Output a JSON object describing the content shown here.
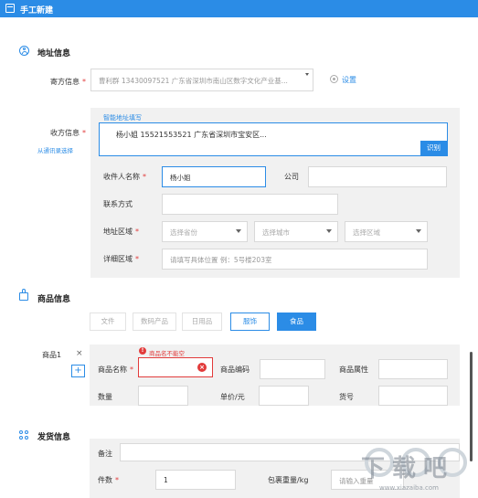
{
  "window": {
    "title": "手工新建"
  },
  "address": {
    "section_title": "地址信息",
    "sender_label": "寄方信息",
    "sender_value": "曹利群 13430097521 广东省深圳市南山区数字文化产业基...",
    "settings_label": "设置",
    "receiver_label": "收方信息",
    "from_address_book": "从通讯录选择",
    "smart_fill_label": "智能地址填写",
    "smart_fill_text": "杨小姐 15521553521 广东省深圳市宝安区...",
    "recognize_button": "识别",
    "name_label": "收件人名称",
    "name_value": "杨小姐",
    "company_label": "公司",
    "contact_label": "联系方式",
    "region_label": "地址区域",
    "province_placeholder": "选择省份",
    "city_placeholder": "选择城市",
    "district_placeholder": "选择区域",
    "detail_label": "详细区域",
    "detail_placeholder": "请填写具体位置 例：5号楼203室"
  },
  "goods": {
    "section_title": "商品信息",
    "categories": [
      {
        "label": "文件",
        "state": "normal"
      },
      {
        "label": "数码产品",
        "state": "normal"
      },
      {
        "label": "日用品",
        "state": "normal"
      },
      {
        "label": "服饰",
        "state": "outline"
      },
      {
        "label": "食品",
        "state": "selected"
      }
    ],
    "item_label": "商品1",
    "remove_symbol": "×",
    "add_symbol": "+",
    "error_text": "商品名不能空",
    "name_label": "商品名称",
    "code_label": "商品编码",
    "attr_label": "商品属性",
    "qty_label": "数量",
    "unit_price_label": "单价/元",
    "sku_label": "货号"
  },
  "shipping": {
    "section_title": "发货信息",
    "remark_label": "备注",
    "pieces_label": "件数",
    "pieces_value": "1",
    "weight_label": "包裹重量/kg",
    "weight_placeholder": "请输入重量"
  },
  "watermark": {
    "text": "下载吧",
    "url": "www.xiazaiba.com"
  },
  "colors": {
    "accent": "#2b8ce6",
    "error": "#e23b3b",
    "required": "#e23b3b"
  }
}
